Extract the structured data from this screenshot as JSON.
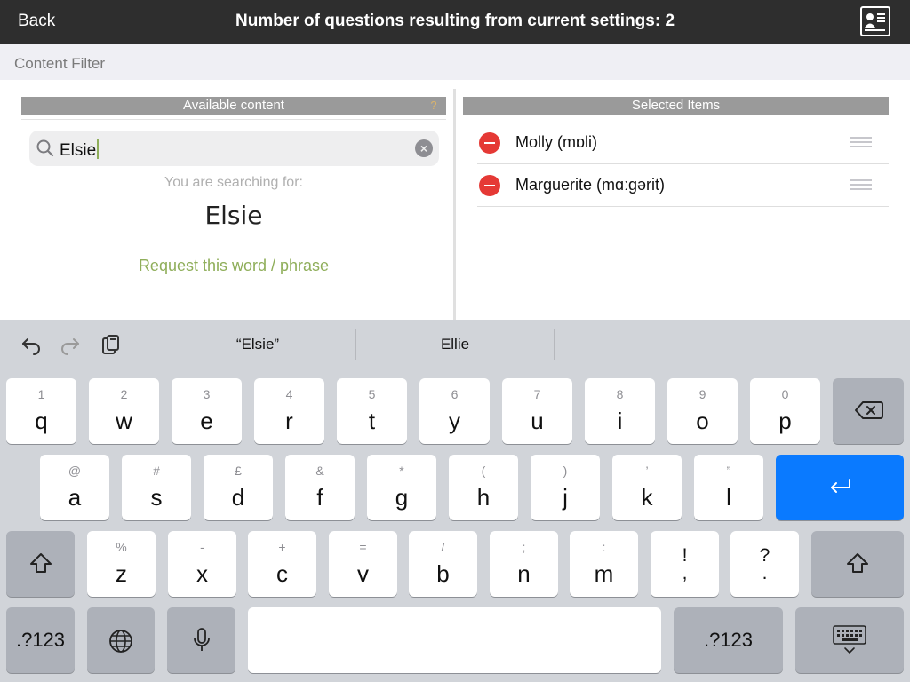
{
  "topbar": {
    "back_label": "Back",
    "title": "Number of questions resulting from current settings: 2",
    "profile_icon": "profile-card-icon"
  },
  "filter": {
    "label": "Content Filter"
  },
  "left_panel": {
    "header": "Available content",
    "help_icon": "?",
    "search_value": "Elsie",
    "searching_for_label": "You are searching for:",
    "search_term": "Elsie",
    "request_link": "Request this word / phrase"
  },
  "right_panel": {
    "header": "Selected Items",
    "items": [
      {
        "label": "Molly (mɒli)"
      },
      {
        "label": "Marguerite (mɑːgərit)"
      }
    ]
  },
  "keyboard": {
    "suggestions": [
      "“Elsie”",
      "Ellie",
      ""
    ],
    "row1": [
      {
        "hint": "1",
        "key": "q"
      },
      {
        "hint": "2",
        "key": "w"
      },
      {
        "hint": "3",
        "key": "e"
      },
      {
        "hint": "4",
        "key": "r"
      },
      {
        "hint": "5",
        "key": "t"
      },
      {
        "hint": "6",
        "key": "y"
      },
      {
        "hint": "7",
        "key": "u"
      },
      {
        "hint": "8",
        "key": "i"
      },
      {
        "hint": "9",
        "key": "o"
      },
      {
        "hint": "0",
        "key": "p"
      }
    ],
    "row2": [
      {
        "hint": "@",
        "key": "a"
      },
      {
        "hint": "#",
        "key": "s"
      },
      {
        "hint": "£",
        "key": "d"
      },
      {
        "hint": "&",
        "key": "f"
      },
      {
        "hint": "*",
        "key": "g"
      },
      {
        "hint": "(",
        "key": "h"
      },
      {
        "hint": ")",
        "key": "j"
      },
      {
        "hint": "’",
        "key": "k"
      },
      {
        "hint": "”",
        "key": "l"
      }
    ],
    "row3": [
      {
        "hint": "%",
        "key": "z"
      },
      {
        "hint": "-",
        "key": "x"
      },
      {
        "hint": "+",
        "key": "c"
      },
      {
        "hint": "=",
        "key": "v"
      },
      {
        "hint": "/",
        "key": "b"
      },
      {
        "hint": ";",
        "key": "n"
      },
      {
        "hint": ":",
        "key": "m"
      }
    ],
    "punct1": {
      "top": "!",
      "bottom": ","
    },
    "punct2": {
      "top": "?",
      "bottom": "."
    },
    "numbers_label": ".?123",
    "numbers_label_right": ".?123"
  }
}
